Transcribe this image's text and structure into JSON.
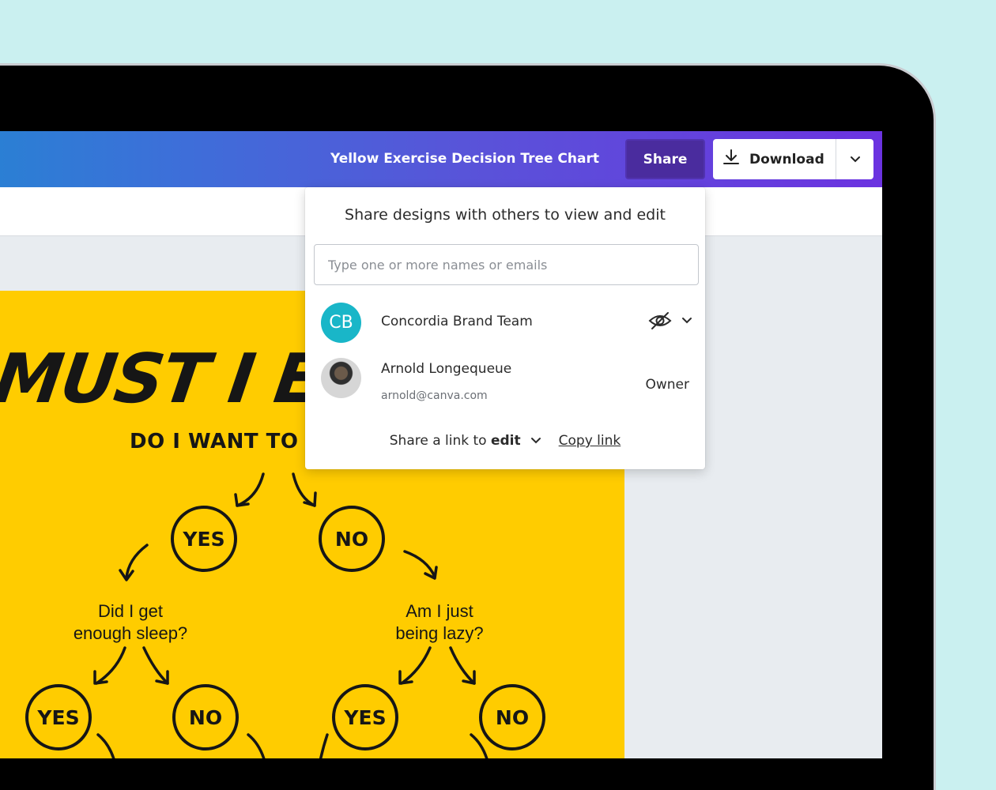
{
  "header": {
    "doc_title": "Yellow Exercise Decision Tree Chart",
    "share_label": "Share",
    "download_label": "Download"
  },
  "poster": {
    "title": "MUST I EX",
    "subtitle": "DO I WANT TO G",
    "nodes": [
      "YES",
      "NO",
      "YES",
      "NO",
      "YES",
      "NO"
    ],
    "question_left_1": "Did I get",
    "question_left_2": "enough sleep?",
    "question_right_1": "Am I just",
    "question_right_2": "being lazy?",
    "background_color": "#ffcc00"
  },
  "share_popover": {
    "heading": "Share designs with others to view and edit",
    "input_placeholder": "Type one or more names or emails",
    "members": [
      {
        "initials": "CB",
        "name": "Concordia Brand Team",
        "permission_icon": "eye-slash-icon",
        "avatar_color": "#19b6c8"
      },
      {
        "name": "Arnold Longequeue",
        "email": "arnold@canva.com",
        "role": "Owner"
      }
    ],
    "footer": {
      "link_prefix": "Share a link to ",
      "link_mode": "edit",
      "copy_link": "Copy link"
    }
  },
  "colors": {
    "background": "#caf0f0",
    "share_button": "#4a2c9e",
    "topbar_start": "#2b7fd4",
    "topbar_end": "#6b33e0"
  }
}
